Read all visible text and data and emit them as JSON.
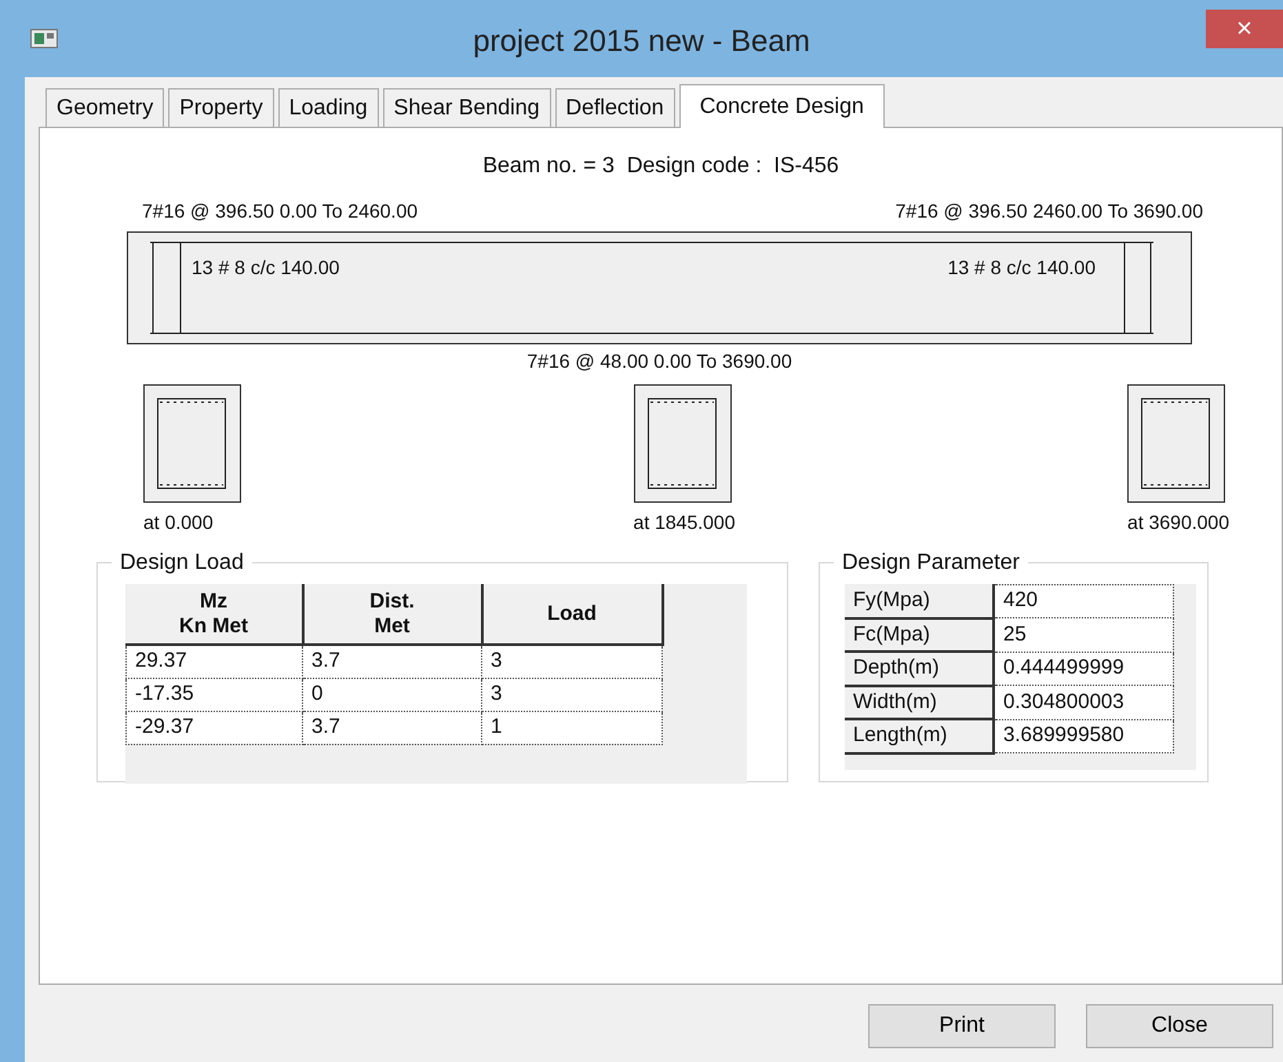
{
  "window": {
    "title": "project 2015 new - Beam",
    "close": "×"
  },
  "tabs": [
    {
      "label": "Geometry",
      "selected": false
    },
    {
      "label": "Property",
      "selected": false
    },
    {
      "label": "Loading",
      "selected": false
    },
    {
      "label": "Shear Bending",
      "selected": false
    },
    {
      "label": "Deflection",
      "selected": false
    },
    {
      "label": "Concrete Design",
      "selected": true
    }
  ],
  "header": "Beam no. = 3  Design code :  IS-456",
  "beam": {
    "top_left": "7#16 @ 396.50 0.00 To 2460.00",
    "top_right": "7#16 @ 396.50 2460.00 To 3690.00",
    "stirrups_left": "13 # 8 c/c 140.00",
    "stirrups_right": "13 # 8 c/c 140.00",
    "bottom": "7#16 @ 48.00 0.00 To 3690.00"
  },
  "sections": [
    {
      "label": "at 0.000"
    },
    {
      "label": "at 1845.000"
    },
    {
      "label": "at 3690.000"
    }
  ],
  "design_load": {
    "title": "Design Load",
    "columns": [
      "Mz\nKn Met",
      "Dist.\nMet",
      "Load"
    ],
    "rows": [
      [
        "29.37",
        "3.7",
        "3"
      ],
      [
        "-17.35",
        "0",
        "3"
      ],
      [
        "-29.37",
        "3.7",
        "1"
      ]
    ]
  },
  "design_parameter": {
    "title": "Design Parameter",
    "rows": [
      {
        "label": "Fy(Mpa)",
        "value": "420"
      },
      {
        "label": "Fc(Mpa)",
        "value": "25"
      },
      {
        "label": "Depth(m)",
        "value": "0.444499999"
      },
      {
        "label": "Width(m)",
        "value": "0.304800003"
      },
      {
        "label": "Length(m)",
        "value": "3.689999580"
      }
    ]
  },
  "buttons": [
    "Print",
    "Close"
  ]
}
